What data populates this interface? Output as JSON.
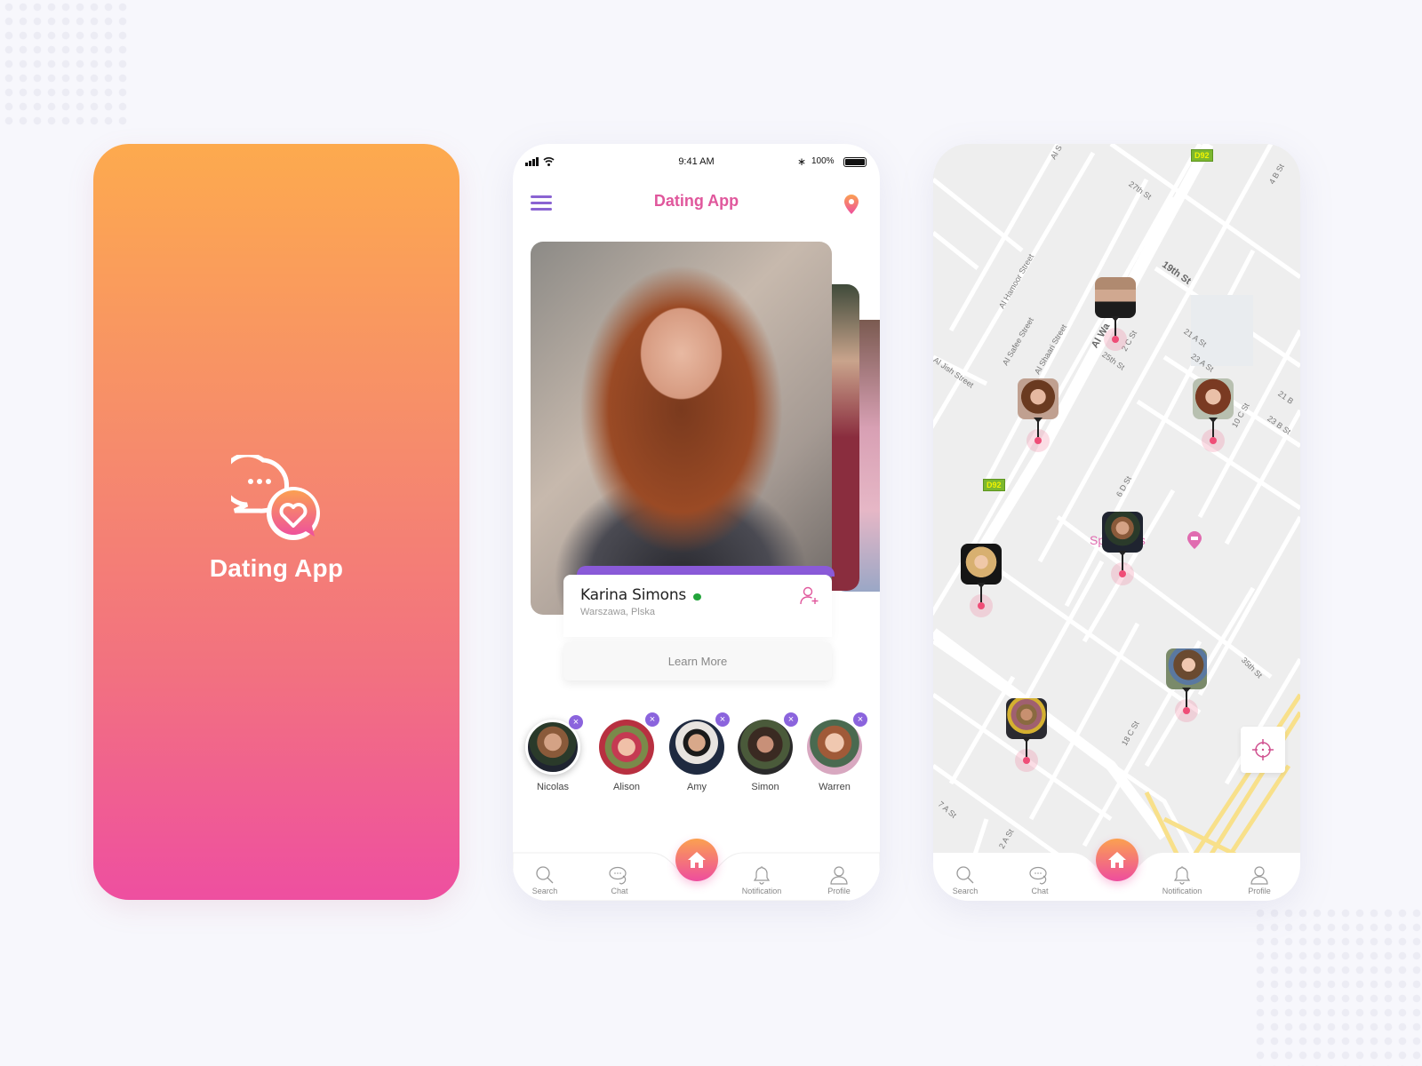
{
  "splash": {
    "title": "Dating App",
    "gradient": [
      "#fdaa4e",
      "#ee4fa0"
    ],
    "icon": "chat-heart-logo-icon"
  },
  "home": {
    "status_bar": {
      "time": "9:41 AM",
      "battery": "100%",
      "icons": [
        "signal-icon",
        "wifi-icon",
        "bluetooth-icon",
        "battery-icon"
      ]
    },
    "app_bar": {
      "title": "Dating App",
      "left_icon": "hamburger-menu-icon",
      "right_icon": "location-pin-icon"
    },
    "featured_profile": {
      "name": "Karina Simons",
      "location": "Warszawa, Plska",
      "online": true,
      "action_icon": "add-user-icon",
      "button": "Learn More"
    },
    "people": [
      {
        "name": "Nicolas",
        "selected": true
      },
      {
        "name": "Alison",
        "selected": false
      },
      {
        "name": "Amy",
        "selected": false
      },
      {
        "name": "Simon",
        "selected": false
      },
      {
        "name": "Warren",
        "selected": false
      }
    ],
    "remove_glyph": "×"
  },
  "tabs": [
    {
      "label": "Search",
      "icon": "search-icon"
    },
    {
      "label": "Chat",
      "icon": "chat-icon"
    },
    {
      "label": "",
      "icon": "home-icon"
    },
    {
      "label": "Notification",
      "icon": "bell-icon"
    },
    {
      "label": "Profile",
      "icon": "user-icon"
    }
  ],
  "map": {
    "streets": [
      "Al S",
      "27th St",
      "4 B St",
      "19th St",
      "Al Hamoor Street",
      "Al Safee Street",
      "Al Shaari Street",
      "Al Wa",
      "2 C St",
      "21 A St",
      "25th St",
      "23 A St",
      "Al Jish Street",
      "10 C St",
      "21 B",
      "23 B St",
      "6 D St",
      "35th St",
      "18 C St",
      "7 A St",
      "2 A St"
    ],
    "road_badges": [
      "D92",
      "D92"
    ],
    "poi": "Sp     r Villas",
    "pins": 7,
    "locate_icon": "crosshair-icon"
  },
  "colors": {
    "accent_purple": "#8a63d2",
    "accent_pink": "#e0579c",
    "online": "#22a43a",
    "pin": "#ef4d77"
  }
}
